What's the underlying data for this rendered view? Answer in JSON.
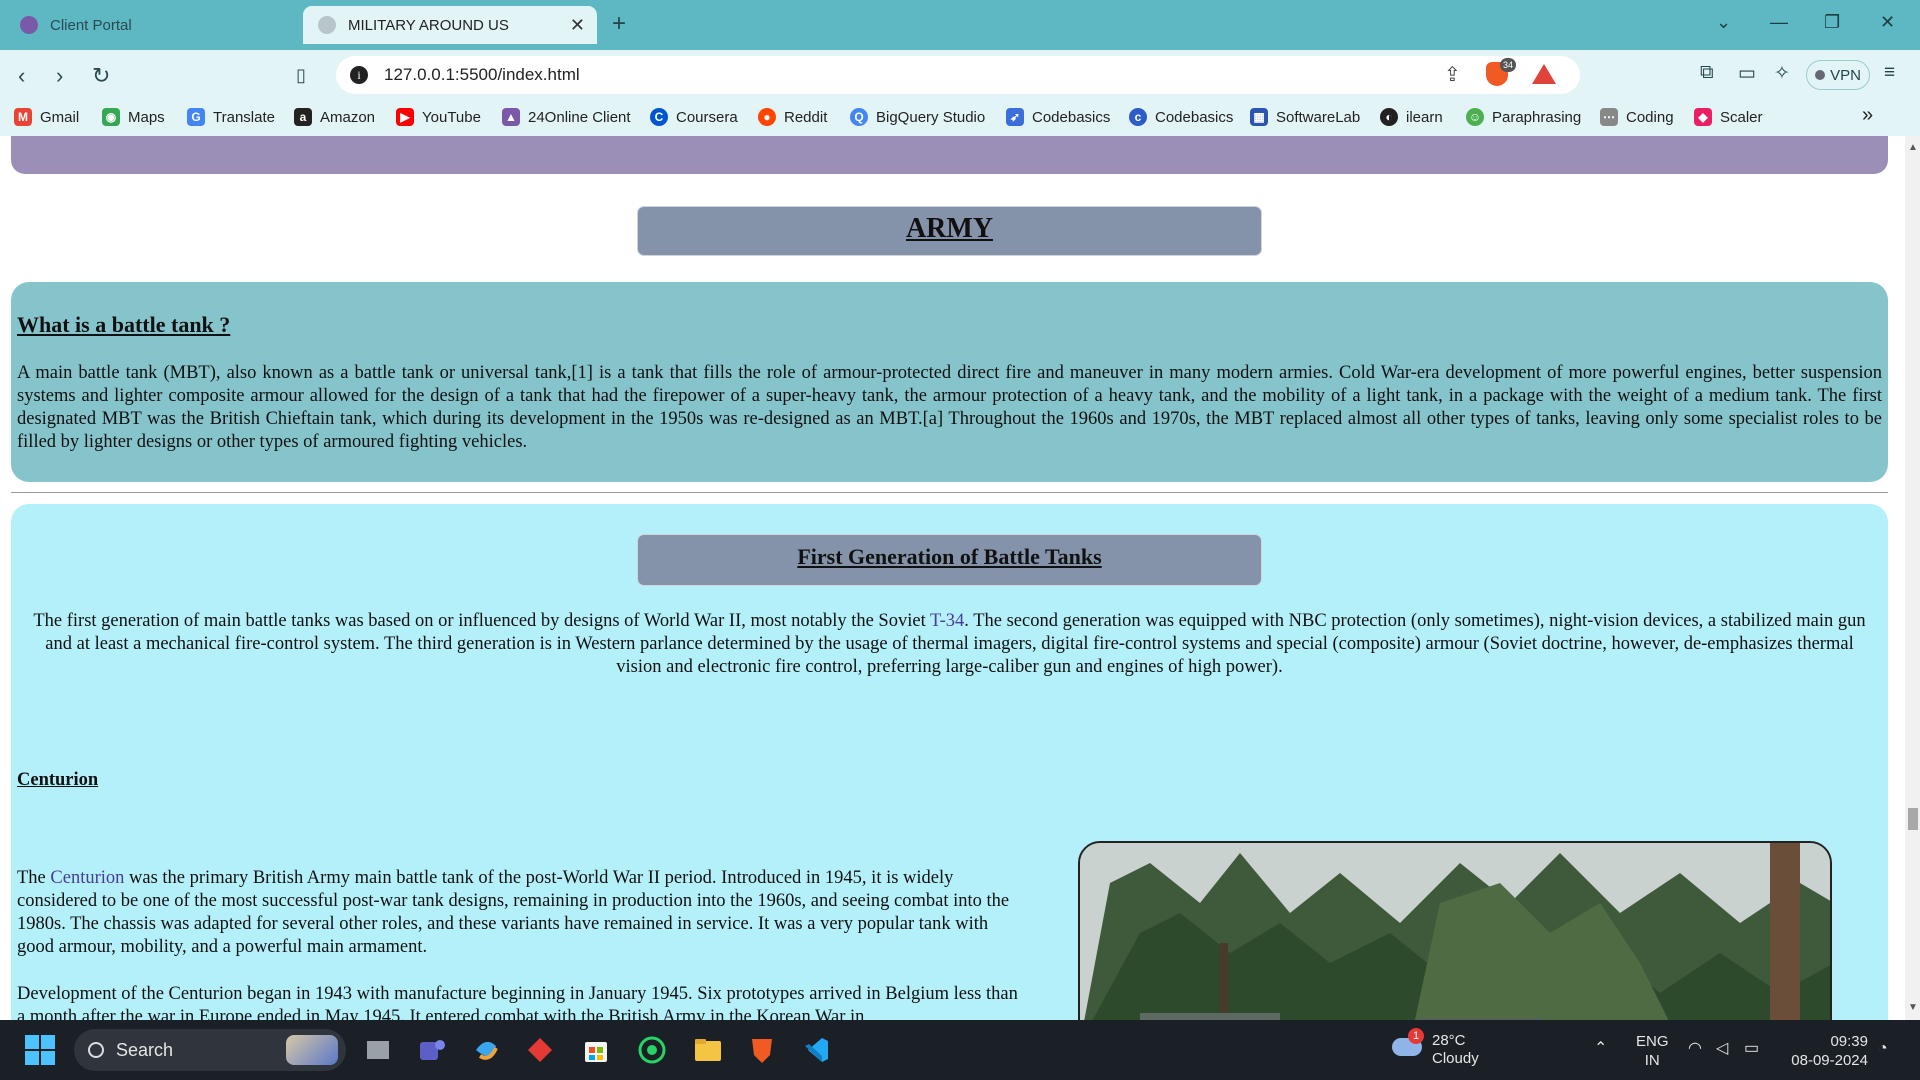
{
  "browser": {
    "tabs": [
      {
        "label": "Client Portal",
        "active": false
      },
      {
        "label": "MILITARY AROUND US",
        "active": true
      }
    ],
    "url": "127.0.0.1:5500/index.html",
    "brave_badge": "34",
    "vpn_label": "VPN",
    "bookmarks": [
      {
        "label": "Gmail",
        "icon": "gmail-icon",
        "color": "#ea4335"
      },
      {
        "label": "Maps",
        "icon": "maps-icon",
        "color": "#34a853"
      },
      {
        "label": "Translate",
        "icon": "translate-icon",
        "color": "#4285f4"
      },
      {
        "label": "Amazon",
        "icon": "amazon-icon",
        "color": "#222222"
      },
      {
        "label": "YouTube",
        "icon": "youtube-icon",
        "color": "#ff0000"
      },
      {
        "label": "24Online Client",
        "icon": "24online-icon",
        "color": "#7a5aa8"
      },
      {
        "label": "Coursera",
        "icon": "coursera-icon",
        "color": "#0056d2"
      },
      {
        "label": "Reddit",
        "icon": "reddit-icon",
        "color": "#ff4500"
      },
      {
        "label": "BigQuery Studio",
        "icon": "bigquery-icon",
        "color": "#4285f4"
      },
      {
        "label": "Codebasics",
        "icon": "codebasics-icon",
        "color": "#3a6ed8"
      },
      {
        "label": "Codebasics",
        "icon": "codebasics-icon",
        "color": "#2c5cc5"
      },
      {
        "label": "SoftwareLab",
        "icon": "softwarelab-icon",
        "color": "#2a55b0"
      },
      {
        "label": "ilearn",
        "icon": "ilearn-icon",
        "color": "#222222"
      },
      {
        "label": "Paraphrasing",
        "icon": "paraphrasing-icon",
        "color": "#4caf50"
      },
      {
        "label": "Coding",
        "icon": "coding-icon",
        "color": "#888888"
      },
      {
        "label": "Scaler",
        "icon": "scaler-icon",
        "color": "#e91e63"
      }
    ]
  },
  "page": {
    "army_heading": "ARMY",
    "tank_section": {
      "title": "What is a battle tank ?",
      "body": "A main battle tank (MBT), also known as a battle tank or universal tank,[1] is a tank that fills the role of armour-protected direct fire and maneuver in many modern armies. Cold War-era development of more powerful engines, better suspension systems and lighter composite armour allowed for the design of a tank that had the firepower of a super-heavy tank, the armour protection of a heavy tank, and the mobility of a light tank, in a package with the weight of a medium tank. The first designated MBT was the British Chieftain tank, which during its development in the 1950s was re-designed as an MBT.[a] Throughout the 1960s and 1970s, the MBT replaced almost all other types of tanks, leaving only some specialist roles to be filled by lighter designs or other types of armoured fighting vehicles."
    },
    "generation_section": {
      "title": "First Generation of Battle Tanks",
      "body_before_link": "The first generation of main battle tanks was based on or influenced by designs of World War II, most notably the Soviet ",
      "link": "T-34",
      "body_after_link": ". The second generation was equipped with NBC protection (only sometimes), night-vision devices, a stabilized main gun and at least a mechanical fire-control system. The third generation is in Western parlance determined by the usage of thermal imagers, digital fire-control systems and special (composite) armour (Soviet doctrine, however, de-emphasizes thermal vision and electronic fire control, preferring large-caliber gun and engines of high power)."
    },
    "centurion": {
      "title": "Centurion",
      "para1_before_link": "The ",
      "para1_link": "Centurion",
      "para1_after_link": " was the primary British Army main battle tank of the post-World War II period. Introduced in 1945, it is widely considered to be one of the most successful post-war tank designs, remaining in production into the 1960s, and seeing combat into the 1980s. The chassis was adapted for several other roles, and these variants have remained in service. It was a very popular tank with good armour, mobility, and a powerful main armament.",
      "para2": "Development of the Centurion began in 1943 with manufacture beginning in January 1945. Six prototypes arrived in Belgium less than a month after the war in Europe ended in May 1945. It entered combat with the British Army in the Korean War in"
    }
  },
  "taskbar": {
    "search_label": "Search",
    "weather_badge": "1",
    "temperature": "28°C",
    "condition": "Cloudy",
    "lang_top": "ENG",
    "lang_bottom": "IN",
    "time": "09:39",
    "date": "08-09-2024"
  },
  "colors": {
    "tabbar": "#5db8c4",
    "toolbar": "#e3f4f7",
    "purple_strip": "#9b8fb8",
    "heading_box": "#8593aa",
    "tank_section": "#86c4cc",
    "generation_section": "#b4f0fa",
    "link": "#4a3c9a"
  }
}
